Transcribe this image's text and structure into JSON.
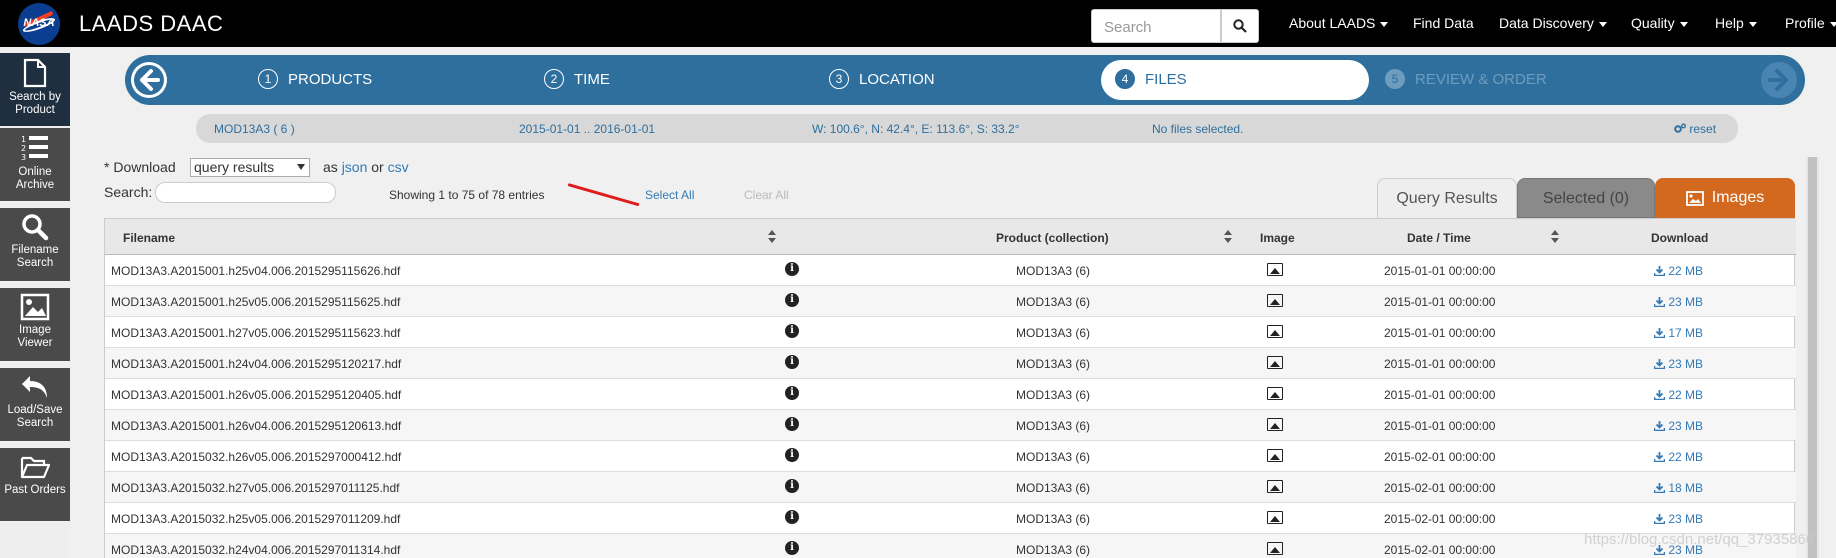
{
  "app": {
    "logo_text": "NASA",
    "brand": "LAADS DAAC"
  },
  "topnav": {
    "search_placeholder": "Search",
    "items": [
      {
        "label": "About LAADS",
        "dropdown": true
      },
      {
        "label": "Find Data",
        "dropdown": false
      },
      {
        "label": "Data Discovery",
        "dropdown": true
      },
      {
        "label": "Quality",
        "dropdown": true
      },
      {
        "label": "Help",
        "dropdown": true
      },
      {
        "label": "Profile",
        "dropdown": true
      }
    ]
  },
  "sidebar": {
    "items": [
      {
        "label1": "Search by",
        "label2": "Product",
        "icon": "file-icon"
      },
      {
        "label1": "Online",
        "label2": "Archive",
        "icon": "list-icon"
      },
      {
        "label1": "Filename",
        "label2": "Search",
        "icon": "magnifier-icon"
      },
      {
        "label1": "Image",
        "label2": "Viewer",
        "icon": "picture-icon"
      },
      {
        "label1": "Load/Save",
        "label2": "Search",
        "icon": "undo-icon"
      },
      {
        "label1": "Past Orders",
        "label2": "",
        "icon": "folder-icon"
      }
    ]
  },
  "wizard": {
    "steps": [
      {
        "num": "1",
        "label": "PRODUCTS"
      },
      {
        "num": "2",
        "label": "TIME"
      },
      {
        "num": "3",
        "label": "LOCATION"
      },
      {
        "num": "4",
        "label": "FILES"
      },
      {
        "num": "5",
        "label": "REVIEW & ORDER"
      }
    ],
    "active_step": 4
  },
  "summary": {
    "product": "MOD13A3 ( 6 )",
    "time": "2015-01-01 .. 2016-01-01",
    "location": "W: 100.6°, N: 42.4°, E: 113.6°, S: 33.2°",
    "files": "No files selected.",
    "reset": "reset"
  },
  "controls": {
    "download_label": "* Download",
    "download_select": "query results",
    "as_label": "as",
    "json_link": "json",
    "or_label": "or",
    "csv_link": "csv",
    "search_label": "Search:",
    "showing": "Showing 1 to 75 of 78 entries",
    "select_all": "Select All",
    "clear_all": "Clear All"
  },
  "tabs": {
    "query_results": "Query Results",
    "selected": "Selected (0)",
    "images": "Images"
  },
  "table": {
    "headers": {
      "filename": "Filename",
      "product": "Product (collection)",
      "image": "Image",
      "datetime": "Date / Time",
      "download": "Download"
    },
    "rows": [
      {
        "filename": "MOD13A3.A2015001.h25v04.006.2015295115626.hdf",
        "product": "MOD13A3 (6)",
        "datetime": "2015-01-01 00:00:00",
        "size": "22 MB"
      },
      {
        "filename": "MOD13A3.A2015001.h25v05.006.2015295115625.hdf",
        "product": "MOD13A3 (6)",
        "datetime": "2015-01-01 00:00:00",
        "size": "23 MB"
      },
      {
        "filename": "MOD13A3.A2015001.h27v05.006.2015295115623.hdf",
        "product": "MOD13A3 (6)",
        "datetime": "2015-01-01 00:00:00",
        "size": "17 MB"
      },
      {
        "filename": "MOD13A3.A2015001.h24v04.006.2015295120217.hdf",
        "product": "MOD13A3 (6)",
        "datetime": "2015-01-01 00:00:00",
        "size": "23 MB"
      },
      {
        "filename": "MOD13A3.A2015001.h26v05.006.2015295120405.hdf",
        "product": "MOD13A3 (6)",
        "datetime": "2015-01-01 00:00:00",
        "size": "22 MB"
      },
      {
        "filename": "MOD13A3.A2015001.h26v04.006.2015295120613.hdf",
        "product": "MOD13A3 (6)",
        "datetime": "2015-01-01 00:00:00",
        "size": "23 MB"
      },
      {
        "filename": "MOD13A3.A2015032.h26v05.006.2015297000412.hdf",
        "product": "MOD13A3 (6)",
        "datetime": "2015-02-01 00:00:00",
        "size": "22 MB"
      },
      {
        "filename": "MOD13A3.A2015032.h27v05.006.2015297011125.hdf",
        "product": "MOD13A3 (6)",
        "datetime": "2015-02-01 00:00:00",
        "size": "18 MB"
      },
      {
        "filename": "MOD13A3.A2015032.h25v05.006.2015297011209.hdf",
        "product": "MOD13A3 (6)",
        "datetime": "2015-02-01 00:00:00",
        "size": "23 MB"
      },
      {
        "filename": "MOD13A3.A2015032.h24v04.006.2015297011314.hdf",
        "product": "MOD13A3 (6)",
        "datetime": "2015-02-01 00:00:00",
        "size": "23 MB"
      }
    ]
  },
  "watermark": "https://blog.csdn.net/qq_37935866"
}
